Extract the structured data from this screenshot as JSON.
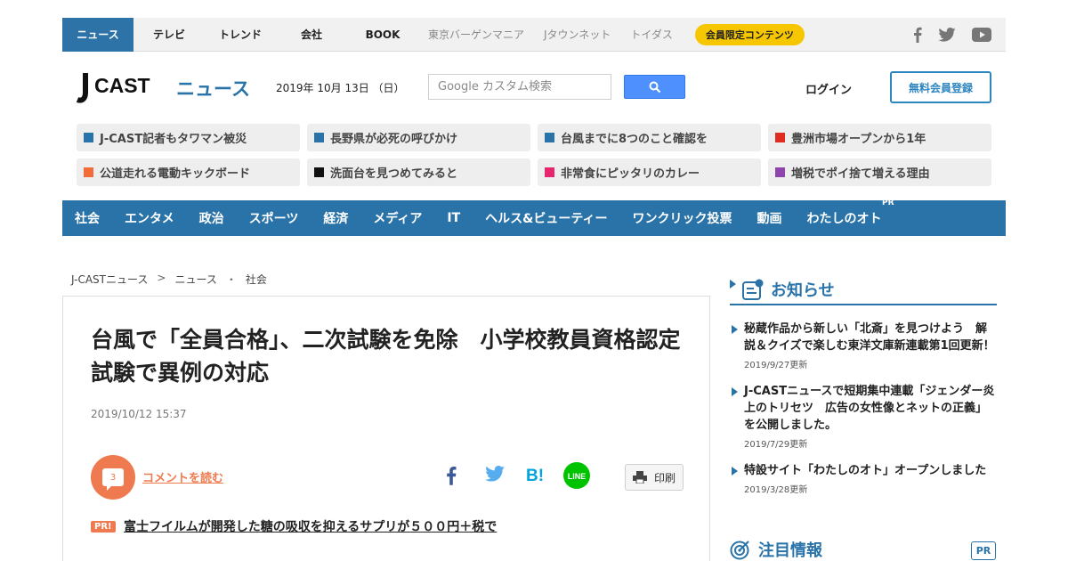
{
  "topnav": {
    "items": [
      "ニュース",
      "テレビ",
      "トレンド",
      "会社",
      "BOOK"
    ],
    "external": [
      "東京バーゲンマニア",
      "Jタウンネット",
      "トイダス"
    ],
    "member_pill": "会員限定コンテンツ",
    "social_icons": [
      "facebook-icon",
      "twitter-icon",
      "youtube-icon"
    ]
  },
  "header": {
    "logo_text": "JCAST ニュース",
    "date": "2019年 10月 13日 （日）",
    "search_placeholder": "Google カスタム検索",
    "login": "ログイン",
    "register": "無料会員登録"
  },
  "chips": [
    {
      "label": "J-CAST記者もタワマン被災",
      "color": "#2a73a9"
    },
    {
      "label": "長野県が必死の呼びかけ",
      "color": "#2a73a9"
    },
    {
      "label": "台風までに8つのこと確認を",
      "color": "#2a73a9"
    },
    {
      "label": "豊洲市場オープンから1年",
      "color": "#e02b20"
    },
    {
      "label": "公道走れる電動キックボード",
      "color": "#f26b38"
    },
    {
      "label": "洗面台を見つめてみると",
      "color": "#111111"
    },
    {
      "label": "非常食にピッタリのカレー",
      "color": "#e8266d"
    },
    {
      "label": "増税でポイ捨て増える理由",
      "color": "#8e44ad"
    }
  ],
  "categories": [
    "社会",
    "エンタメ",
    "政治",
    "スポーツ",
    "経済",
    "メディア",
    "IT",
    "ヘルス&ビューティー",
    "ワンクリック投票",
    "動画",
    "わたしのオト"
  ],
  "category_pr": "PR",
  "breadcrumb": [
    "J-CASTニュース",
    ">",
    "ニュース",
    "・",
    "社会"
  ],
  "article": {
    "headline": "台風で「全員合格」、二次試験を免除　小学校教員資格認定試験で異例の対応",
    "date": "2019/10/12 15:37",
    "comment_count": "3",
    "comment_label": "コメントを読む",
    "print_label": "印刷",
    "share_icons": [
      "facebook-icon",
      "twitter-icon",
      "hatena-bookmark-icon",
      "line-icon"
    ],
    "pr_tag": "PR!",
    "pr_link": "富士フイルムが開発した糖の吸収を抑えるサプリが５００円＋税で"
  },
  "sidebar": {
    "notice_title": "お知らせ",
    "notices": [
      {
        "text": "秘蔵作品から新しい「北斎」を見つけよう　解説＆クイズで楽しむ東洋文庫新連載第1回更新！",
        "date": "2019/9/27更新"
      },
      {
        "text": "J-CASTニュースで短期集中連載「ジェンダー炎上のトリセツ　広告の女性像とネットの正義」を公開しました。",
        "date": "2019/7/29更新"
      },
      {
        "text": "特設サイト「わたしのオト」オープンしました",
        "date": "2019/3/28更新"
      }
    ],
    "attention_title": "注目情報",
    "attention_pr": "PR"
  },
  "colors": {
    "brand_blue": "#2a73a9",
    "comment_orange": "#ef7a4f",
    "member_yellow": "#f6c600"
  }
}
